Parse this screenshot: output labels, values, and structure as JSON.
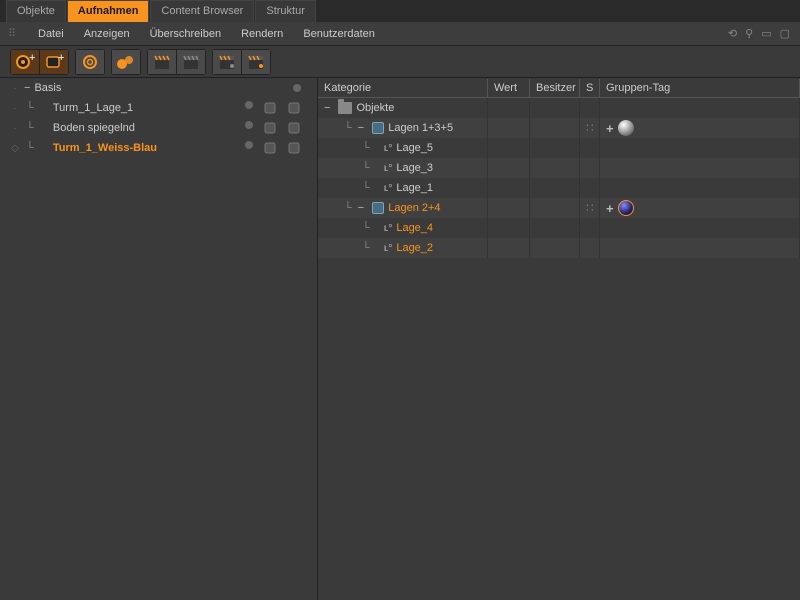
{
  "tabs": {
    "items": [
      "Objekte",
      "Aufnahmen",
      "Content Browser",
      "Struktur"
    ],
    "active": 1
  },
  "menu": {
    "items": [
      "Datei",
      "Anzeigen",
      "Überschreiben",
      "Rendern",
      "Benutzerdaten"
    ]
  },
  "left_tree": [
    {
      "name": "Basis",
      "hl": false,
      "expander": "−",
      "indent": 0,
      "icons": [
        "dot"
      ]
    },
    {
      "name": "Turm_1_Lage_1",
      "hl": false,
      "expander": "",
      "indent": 1,
      "icons": [
        "dot",
        "ico",
        "ico"
      ]
    },
    {
      "name": "Boden spiegelnd",
      "hl": false,
      "expander": "",
      "indent": 1,
      "icons": [
        "dot",
        "ico",
        "ico"
      ]
    },
    {
      "name": "Turm_1_Weiss-Blau",
      "hl": true,
      "expander": "",
      "indent": 1,
      "icons": [
        "dot",
        "ico",
        "ico"
      ]
    }
  ],
  "grid": {
    "headers": {
      "cat": "Kategorie",
      "val": "Wert",
      "own": "Besitzer",
      "s": "S",
      "tag": "Gruppen-Tag"
    },
    "rows": [
      {
        "type": "folder",
        "label": "Objekte",
        "indent": 0,
        "exp": "−",
        "hl": false,
        "alt": false
      },
      {
        "type": "node",
        "label": "Lagen 1+3+5",
        "indent": 1,
        "exp": "−",
        "hl": false,
        "s": true,
        "tag": "silver",
        "alt": true
      },
      {
        "type": "level",
        "label": "Lage_5",
        "indent": 2,
        "exp": "",
        "hl": false,
        "alt": false
      },
      {
        "type": "level",
        "label": "Lage_3",
        "indent": 2,
        "exp": "",
        "hl": false,
        "alt": true
      },
      {
        "type": "level",
        "label": "Lage_1",
        "indent": 2,
        "exp": "",
        "hl": false,
        "alt": false
      },
      {
        "type": "node",
        "label": "Lagen 2+4",
        "indent": 1,
        "exp": "−",
        "hl": true,
        "s": true,
        "tag": "blue",
        "alt": true
      },
      {
        "type": "level",
        "label": "Lage_4",
        "indent": 2,
        "exp": "",
        "hl": true,
        "alt": false
      },
      {
        "type": "level",
        "label": "Lage_2",
        "indent": 2,
        "exp": "",
        "hl": true,
        "alt": true
      }
    ]
  }
}
